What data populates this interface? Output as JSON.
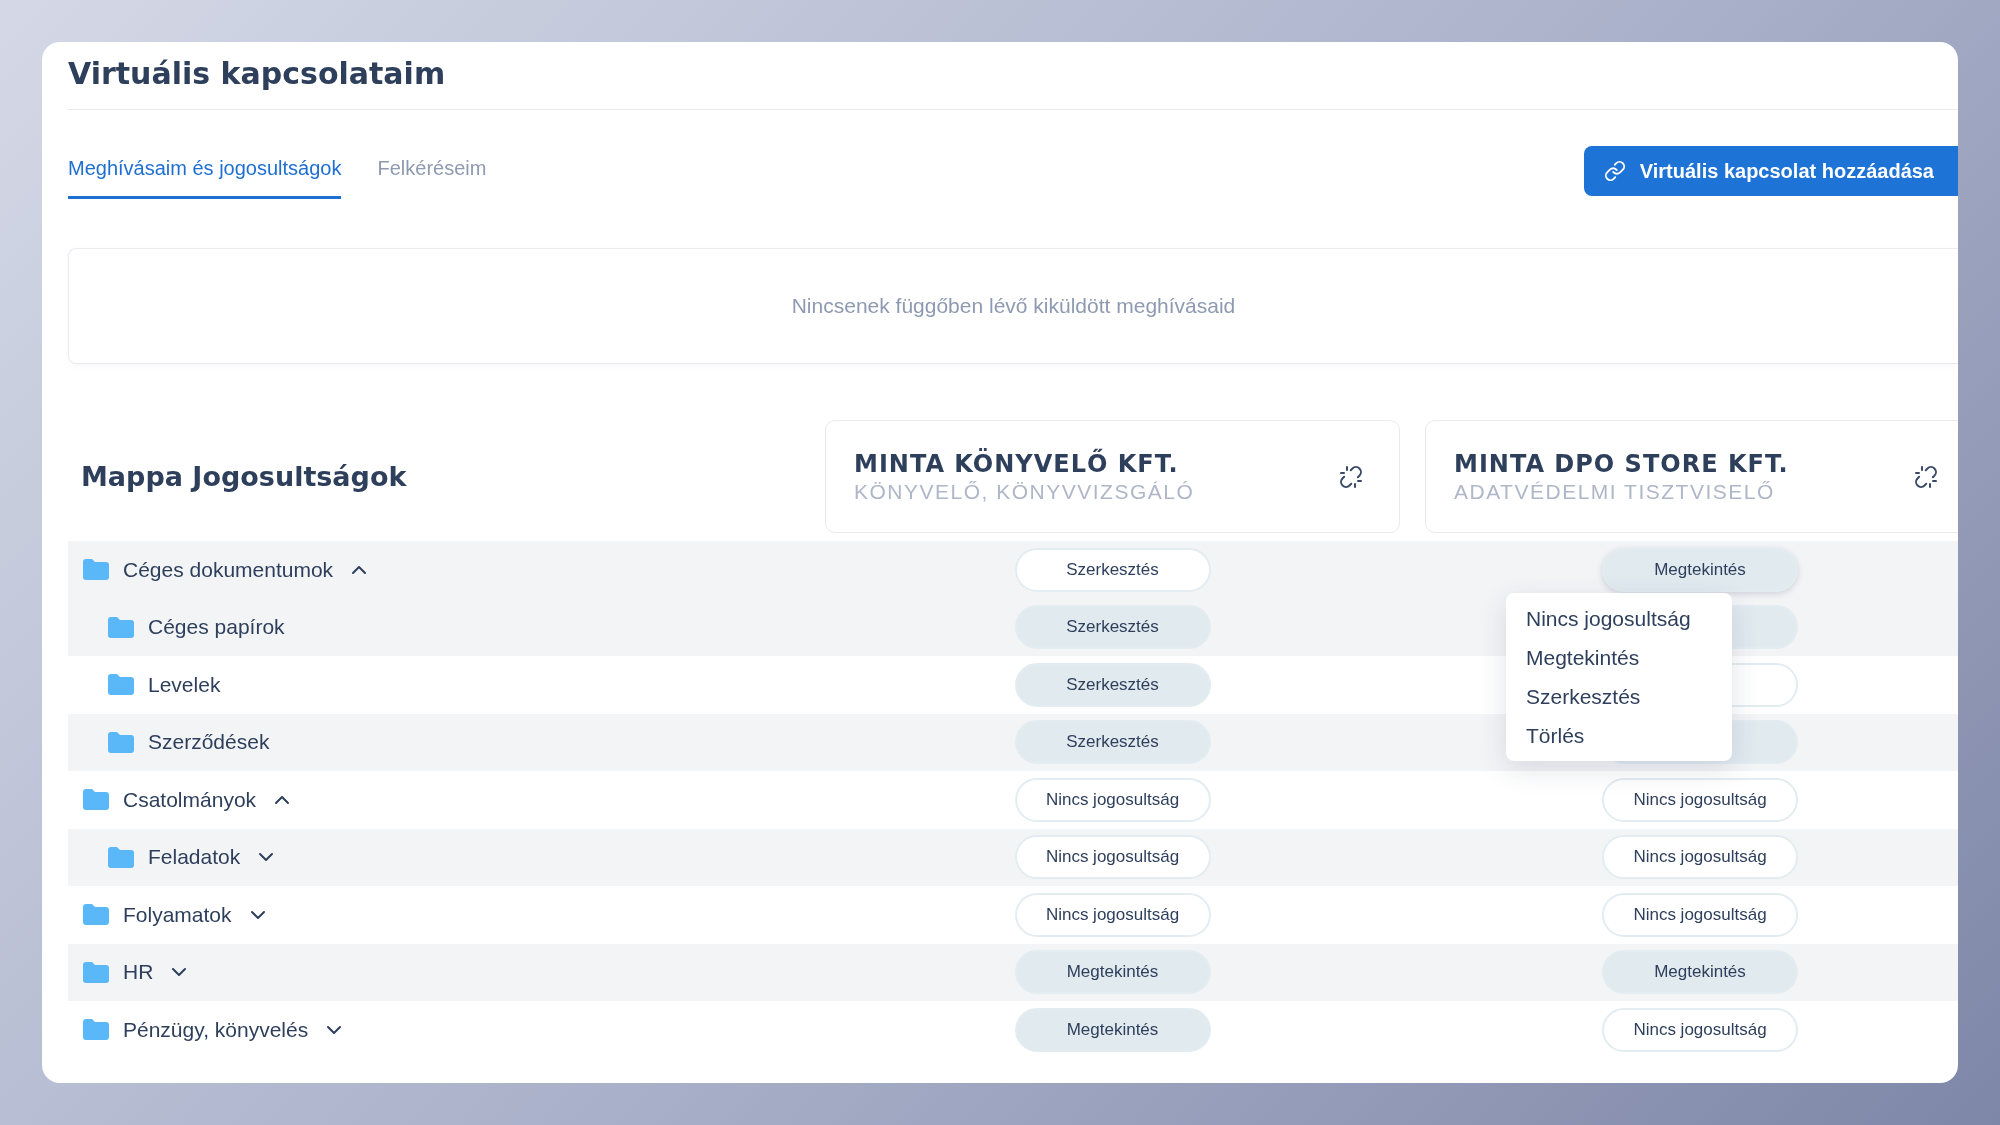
{
  "title": "Virtuális kapcsolataim",
  "tabs": [
    {
      "label": "Meghívásaim és jogosultságok",
      "selected": true
    },
    {
      "label": "Felkéréseim",
      "selected": false
    }
  ],
  "add_button": "Virtuális kapcsolat hozzáadása",
  "empty_state": "Nincsenek függőben lévő kiküldött meghívásaid",
  "table": {
    "heading": "Mappa Jogosultságok",
    "columns": [
      {
        "name": "MINTA KÖNYVELŐ KFT.",
        "role": "KÖNYVELŐ, KÖNYVVIZSGÁLÓ"
      },
      {
        "name": "MINTA DPO STORE KFT.",
        "role": "ADATVÉDELMI TISZTVISELŐ"
      }
    ],
    "folders": [
      {
        "name": "Céges dokumentumok",
        "expanded": true,
        "highlighted": true,
        "permissions": [
          {
            "label": "Szerkesztés",
            "filled": false,
            "open": false
          },
          {
            "label": "Megtekintés",
            "filled": true,
            "open": true
          }
        ],
        "children": [
          {
            "name": "Céges papírok",
            "highlighted": false,
            "permissions": [
              {
                "label": "Szerkesztés",
                "filled": true,
                "open": false
              },
              {
                "filled": true,
                "open": false
              }
            ]
          },
          {
            "name": "Levelek",
            "highlighted": false,
            "permissions": [
              {
                "label": "Szerkesztés",
                "filled": true,
                "open": false
              },
              {
                "filled": false,
                "open": false
              }
            ]
          },
          {
            "name": "Szerződések",
            "highlighted": false,
            "permissions": [
              {
                "label": "Szerkesztés",
                "filled": true,
                "open": false
              },
              {
                "filled": true,
                "open": false
              }
            ]
          }
        ]
      },
      {
        "name": "Csatolmányok",
        "expanded": true,
        "highlighted": false,
        "permissions": [
          {
            "label": "Nincs jogosultság",
            "filled": false,
            "open": false
          },
          {
            "label": "Nincs jogosultság",
            "filled": false,
            "open": false
          }
        ],
        "children": [
          {
            "name": "Feladatok",
            "expanded": false,
            "highlighted": false,
            "permissions": [
              {
                "label": "Nincs jogosultság",
                "filled": false,
                "open": false
              },
              {
                "label": "Nincs jogosultság",
                "filled": false,
                "open": false
              }
            ]
          }
        ]
      },
      {
        "name": "Folyamatok",
        "expanded": false,
        "highlighted": false,
        "permissions": [
          {
            "label": "Nincs jogosultság",
            "filled": false,
            "open": false
          },
          {
            "label": "Nincs jogosultság",
            "filled": false,
            "open": false
          }
        ]
      },
      {
        "name": "HR",
        "expanded": false,
        "highlighted": false,
        "permissions": [
          {
            "label": "Megtekintés",
            "filled": true,
            "open": false
          },
          {
            "label": "Megtekintés",
            "filled": true,
            "open": false
          }
        ]
      },
      {
        "name": "Pénzügy, könyvelés",
        "expanded": false,
        "highlighted": false,
        "permissions": [
          {
            "label": "Megtekintés",
            "filled": true,
            "open": false
          },
          {
            "label": "Nincs jogosultság",
            "filled": false,
            "open": false
          }
        ]
      }
    ]
  },
  "permission_menu": {
    "items": [
      "Nincs jogosultság",
      "Megtekintés",
      "Szerkesztés",
      "Törlés"
    ]
  }
}
